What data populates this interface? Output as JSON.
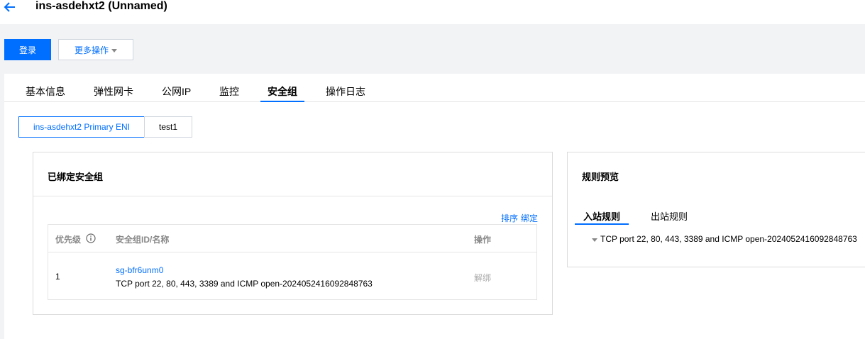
{
  "header": {
    "title": "ins-asdehxt2 (Unnamed)"
  },
  "actions": {
    "login_label": "登录",
    "more_label": "更多操作"
  },
  "tabs": [
    {
      "label": "基本信息"
    },
    {
      "label": "弹性网卡"
    },
    {
      "label": "公网IP"
    },
    {
      "label": "监控"
    },
    {
      "label": "安全组"
    },
    {
      "label": "操作日志"
    }
  ],
  "active_tab": "安全组",
  "eni_tabs": [
    {
      "label": "ins-asdehxt2 Primary ENI"
    },
    {
      "label": "test1"
    }
  ],
  "bound_card": {
    "title": "已绑定安全组",
    "sort_label": "排序",
    "bind_label": "绑定",
    "columns": {
      "priority": "优先级",
      "id_name": "安全组ID/名称",
      "action": "操作"
    },
    "rows": [
      {
        "priority": "1",
        "sg_id": "sg-bfr6unm0",
        "sg_name": "TCP port 22, 80, 443, 3389 and ICMP open-2024052416092848763",
        "action": "解绑"
      }
    ]
  },
  "preview_card": {
    "title": "规则预览",
    "tabs": [
      {
        "label": "入站规则"
      },
      {
        "label": "出站规则"
      }
    ],
    "rule_group": "TCP port 22, 80, 443, 3389 and ICMP open-2024052416092848763"
  },
  "colors": {
    "primary": "#006eff",
    "page_bg": "#f2f3f5",
    "border": "#dcdcdc",
    "muted": "#888888"
  }
}
